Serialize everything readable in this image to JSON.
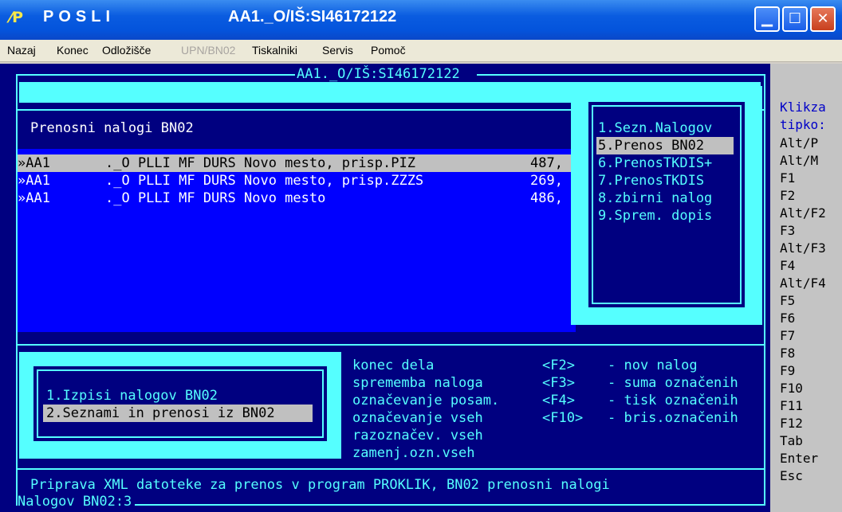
{
  "window": {
    "app_name": "POSLI",
    "doc_title": "AA1._O/IŠ:SI46172122",
    "logo_glyph": "⁄P",
    "min_glyph": "▁",
    "max_glyph": "☐",
    "close_glyph": "✕"
  },
  "menu": [
    "Nazaj",
    "Konec",
    "Odložišče",
    "UPN/BN02",
    "Tiskalniki",
    "Servis",
    "Pomoč"
  ],
  "console": {
    "frame_title": "AA1._O/IŠ:SI46172122",
    "section_title": "Prenosni nalogi BN02",
    "rows": [
      {
        "marker": "»AA1",
        "text": "._O PLLI MF DURS Novo mesto, prisp.PIZ",
        "amount": "487,",
        "selected": true
      },
      {
        "marker": "»AA1",
        "text": "._O PLLI MF DURS Novo mesto, prisp.ZZZS",
        "amount": "269,",
        "selected": false
      },
      {
        "marker": "»AA1",
        "text": "._O PLLI MF DURS Novo mesto",
        "amount": "486,",
        "selected": false
      }
    ],
    "right_menu": [
      {
        "label": "1.Sezn.Nalogov",
        "selected": false
      },
      {
        "label": "5.Prenos BN02",
        "selected": true
      },
      {
        "label": "6.PrenosTKDIS+",
        "selected": false
      },
      {
        "label": "7.PrenosTKDIS",
        "selected": false
      },
      {
        "label": "8.zbirni nalog",
        "selected": false
      },
      {
        "label": "9.Sprem. dopis",
        "selected": false
      }
    ],
    "left_menu": [
      {
        "label": "1.Izpisi nalogov BN02",
        "selected": false
      },
      {
        "label": "2.Seznami in prenosi iz BN02",
        "selected": true
      }
    ],
    "help_left": [
      "konec dela",
      "sprememba naloga",
      "označevanje posam.",
      "označevanje vseh",
      "razoznačev. vseh",
      "zamenj.ozn.vseh"
    ],
    "help_keys": [
      {
        "key": "<F2>",
        "desc": "- nov nalog"
      },
      {
        "key": "<F3>",
        "desc": "- suma označenih"
      },
      {
        "key": "<F4>",
        "desc": "- tisk označenih"
      },
      {
        "key": "<F10>",
        "desc": "- bris.označenih"
      }
    ],
    "status_line": "Priprava XML datoteke za prenos v program PROKLIK, BN02 prenosni nalogi",
    "footer": "Nalogov BN02:3"
  },
  "sidebar": {
    "header1": "Klikza",
    "header2": "tipko:",
    "keys": [
      "Alt/P",
      "Alt/M",
      "F1",
      "F2",
      "Alt/F2",
      "F3",
      "Alt/F3",
      "F4",
      "Alt/F4",
      "F5",
      "F6",
      "F7",
      "F8",
      "F9",
      "F10",
      "F11",
      "F12",
      "Tab",
      "Enter",
      "Esc"
    ]
  },
  "colors": {
    "console_bg": "#000080",
    "list_bg": "#0000ff",
    "cyan": "#55ffff",
    "highlight": "#c0c0c0",
    "titlebar": "#0a5ce0"
  }
}
